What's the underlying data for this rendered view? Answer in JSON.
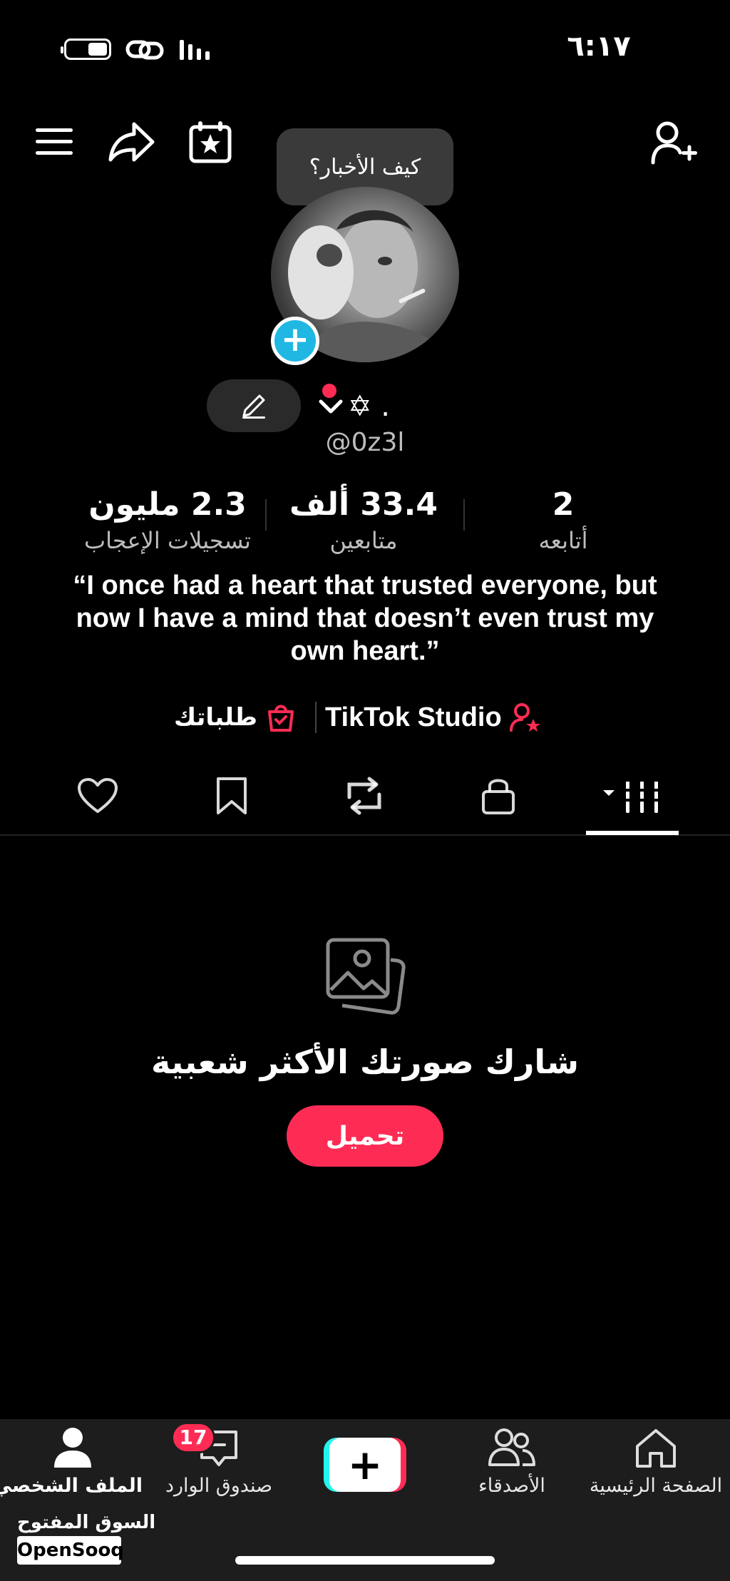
{
  "status_bar": {
    "time": "٦:١٧"
  },
  "header": {
    "tooltip": "كيف الأخبار؟",
    "icons": [
      "menu-icon",
      "share-icon",
      "calendar-star-icon",
      "add-user-icon"
    ]
  },
  "profile": {
    "display_name": "✡︎ .",
    "username": "@0z3l",
    "stats": [
      {
        "value": "2.3 مليون",
        "label": "تسجيلات الإعجاب"
      },
      {
        "value": "33.4 ألف",
        "label": "متابعين"
      },
      {
        "value": "2",
        "label": "أتابعه"
      }
    ],
    "bio": "“I once had a heart that trusted everyone, but now I have a mind that doesn’t even trust my own heart.”",
    "links": {
      "orders": "طلباتك",
      "studio": "TikTok Studio"
    }
  },
  "tabs": [
    "liked-tab",
    "saved-tab",
    "reposts-tab",
    "private-tab",
    "videos-tab"
  ],
  "empty_state": {
    "title": "شارك صورتك الأكثر شعبية",
    "button": "تحميل"
  },
  "bottom_nav": {
    "items": [
      {
        "label": "الملف الشخصي"
      },
      {
        "label": "صندوق الوارد",
        "badge": "17"
      },
      {
        "label": ""
      },
      {
        "label": "الأصدقاء"
      },
      {
        "label": "الصفحة الرئيسية"
      }
    ]
  },
  "watermark": {
    "arabic": "السوق المفتوح",
    "english": "OpenSooq"
  },
  "colors": {
    "accent": "#fe2c55",
    "cyan": "#25f4ee",
    "plus_blue": "#20b7e3"
  }
}
